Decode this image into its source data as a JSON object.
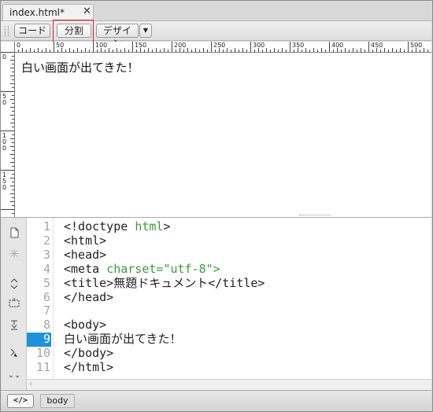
{
  "document_tab": {
    "title": "index.html*",
    "close_glyph": "✕"
  },
  "toolbar": {
    "code_label": "コード",
    "split_label": "分割",
    "design_label": "デザイン",
    "dropdown_glyph": "▼",
    "highlight_color": "#d92020"
  },
  "ruler": {
    "top_labels": [
      "0",
      "50",
      "100",
      "150",
      "200",
      "250",
      "300",
      "350",
      "400",
      "450",
      "500"
    ],
    "left_labels": [
      "0",
      "50",
      "100",
      "150"
    ]
  },
  "design_view": {
    "text": "白い画面が出てきた！"
  },
  "code_view": {
    "active_line": 9,
    "active_color": "#1f91d8",
    "line_numbers": [
      "1",
      "2",
      "3",
      "4",
      "5",
      "6",
      "7",
      "8",
      "9",
      "10",
      "11"
    ],
    "lines": [
      {
        "pre": "<!doctype ",
        "attr": "html",
        "post": ">"
      },
      {
        "pre": "<html>",
        "attr": "",
        "post": ""
      },
      {
        "pre": "<head>",
        "attr": "",
        "post": ""
      },
      {
        "pre": "<meta ",
        "attr": "charset=",
        "post": "\"utf-8\">"
      },
      {
        "pre": "<title>無題ドキュメント</title>",
        "attr": "",
        "post": ""
      },
      {
        "pre": "</head>",
        "attr": "",
        "post": ""
      },
      {
        "pre": "",
        "attr": "",
        "post": ""
      },
      {
        "pre": "<body>",
        "attr": "",
        "post": ""
      },
      {
        "pre": "白い画面が出てきた！",
        "attr": "",
        "post": ""
      },
      {
        "pre": "</body>",
        "attr": "",
        "post": ""
      },
      {
        "pre": "</html>",
        "attr": "",
        "post": ""
      }
    ],
    "tools": [
      "open-documents-icon",
      "asterisk-icon",
      "expand-icon",
      "select-parent-icon",
      "balance-braces-icon",
      "collapse-icon",
      "more-icon"
    ]
  },
  "status_bar": {
    "tag_button": "</>",
    "breadcrumb": "body"
  }
}
